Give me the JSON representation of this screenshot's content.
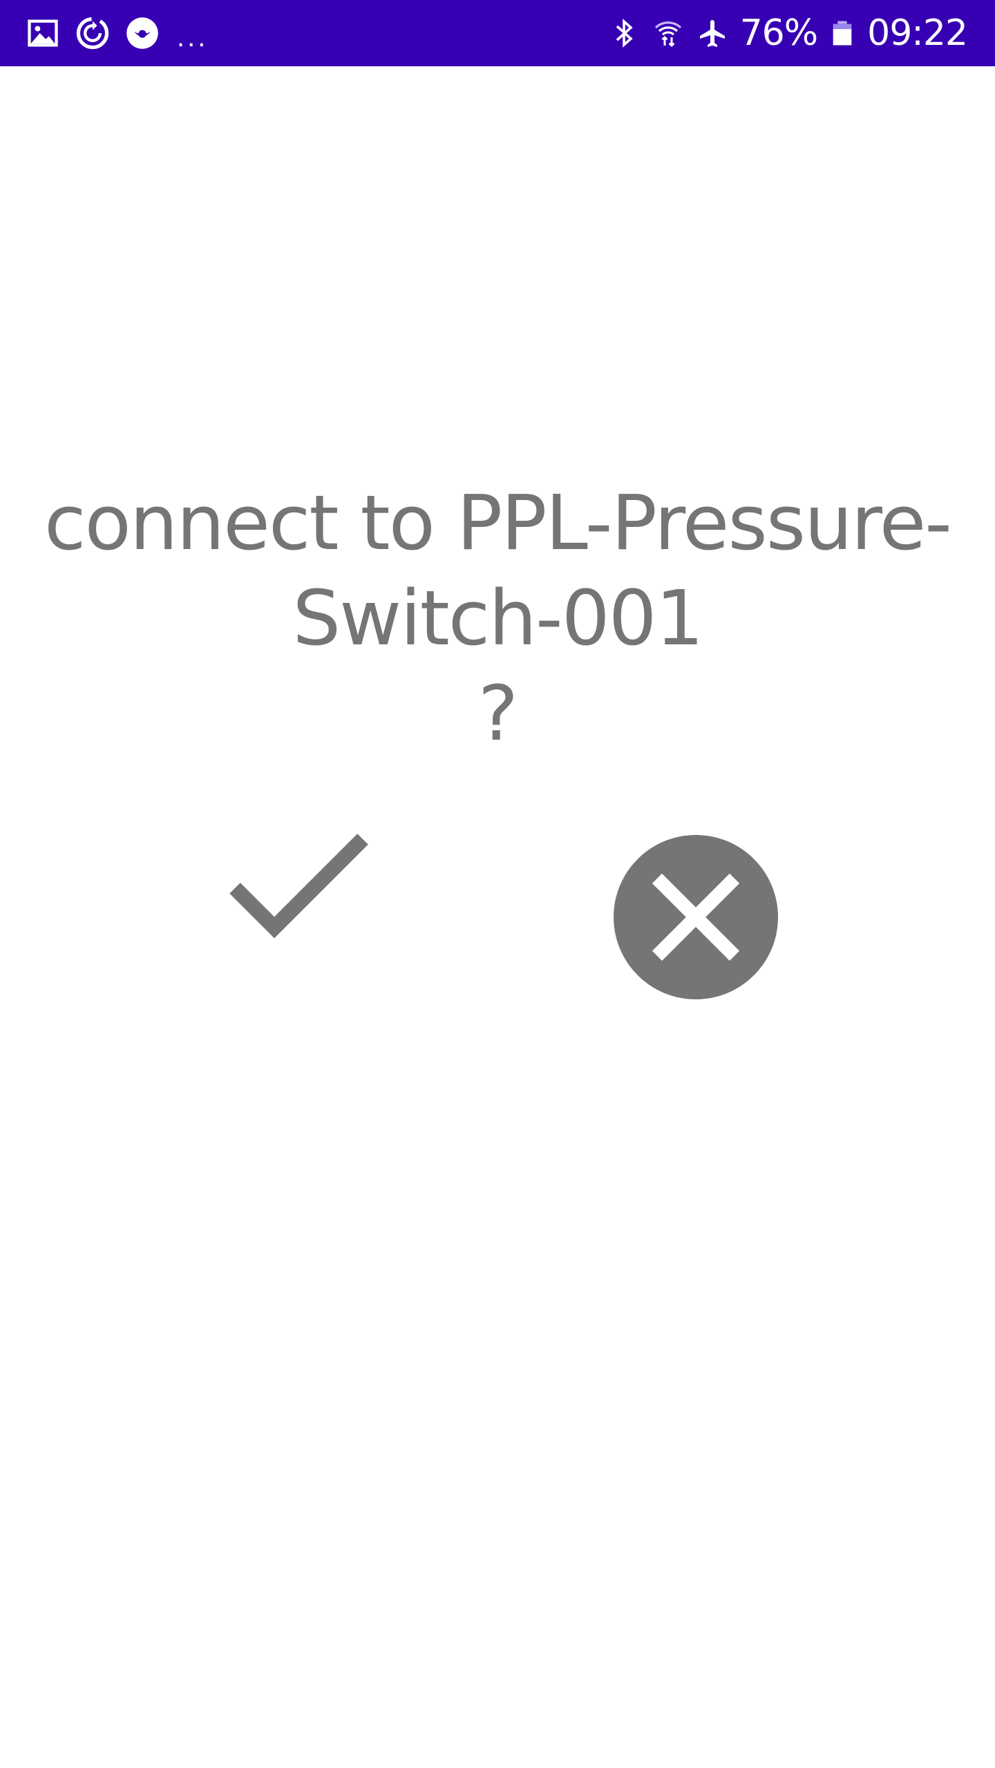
{
  "status_bar": {
    "background": "#3700b3",
    "left_icons": [
      "gallery-icon",
      "sync-icon",
      "app-icon"
    ],
    "more_indicator": "...",
    "right_icons": [
      "bluetooth-icon",
      "wifi-icon",
      "airplane-icon",
      "battery-icon"
    ],
    "battery_percent": "76%",
    "clock": "09:22"
  },
  "dialog": {
    "prompt_line1": "connect to PPL-Pressure-",
    "prompt_line2": "Switch-001",
    "prompt_line3": "?",
    "text_color": "#757575",
    "confirm_icon": "check-icon",
    "cancel_icon": "close-icon"
  }
}
